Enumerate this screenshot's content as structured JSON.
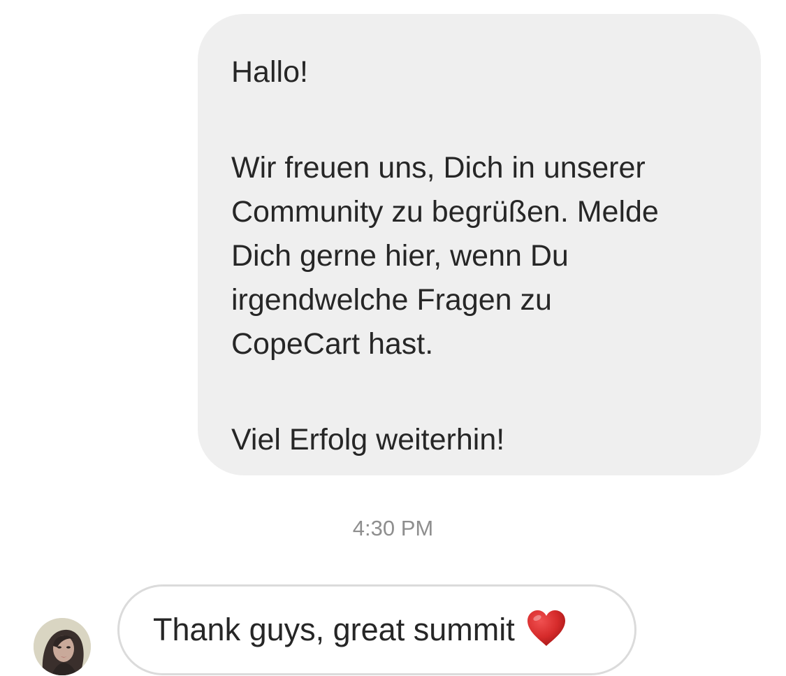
{
  "conversation": {
    "sent_message": {
      "paragraphs": [
        [
          "Hallo!"
        ],
        [
          "Wir freuen uns, Dich in unserer",
          "Community zu begrüßen. Melde",
          "Dich gerne hier, wenn Du",
          "irgendwelche Fragen zu",
          "CopeCart hast."
        ],
        [
          "Viel Erfolg weiterhin!"
        ]
      ]
    },
    "timestamp": "4:30 PM",
    "received_message": {
      "text": "Thank guys, great summit",
      "emoji_icon": "red-heart-icon"
    }
  },
  "colors": {
    "sent_bubble": "#efefef",
    "received_border": "#dbdbdb",
    "timestamp": "#8e8e8e",
    "text": "#262626",
    "heart": "#d62b2b"
  }
}
